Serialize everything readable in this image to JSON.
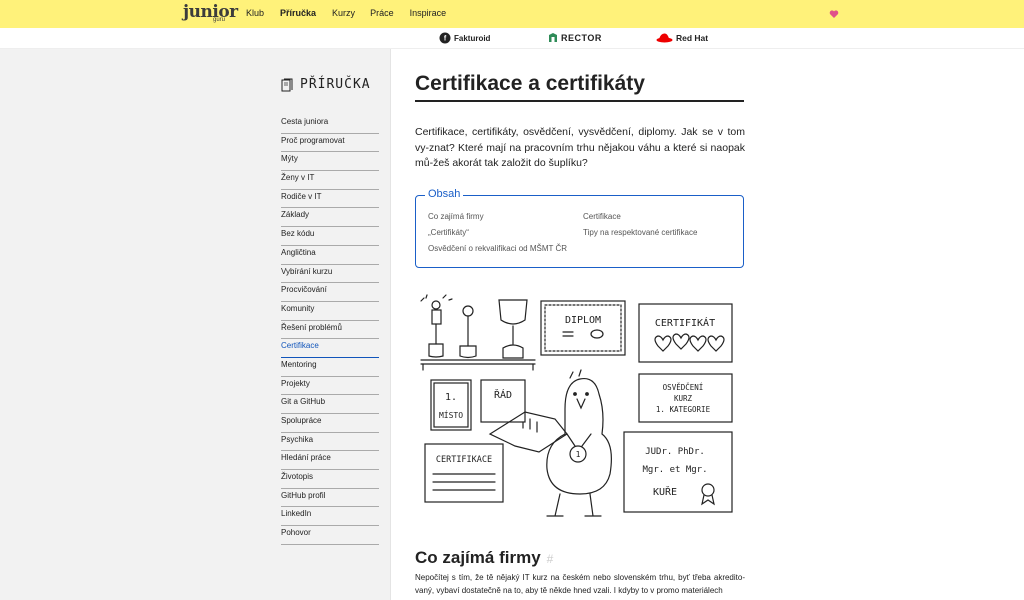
{
  "header": {
    "logo_main": "junior",
    "logo_sub": "guru",
    "nav": [
      "Klub",
      "Příručka",
      "Kurzy",
      "Práce",
      "Inspirace"
    ],
    "active_nav": "Příručka",
    "heart_color": "#e0508a",
    "bg_color": "#fff27a"
  },
  "sponsors": [
    "Fakturoid",
    "RECTOR",
    "Red Hat"
  ],
  "sidebar": {
    "title": "PŘÍRUČKA",
    "items": [
      "Cesta juniora",
      "Proč programovat",
      "Mýty",
      "Ženy v IT",
      "Rodiče v IT",
      "Základy",
      "Bez kódu",
      "Angličtina",
      "Vybírání kurzu",
      "Procvičování",
      "Komunity",
      "Řešení problémů",
      "Certifikace",
      "Mentoring",
      "Projekty",
      "Git a GitHub",
      "Spolupráce",
      "Psychika",
      "Hledání práce",
      "Životopis",
      "GitHub profil",
      "LinkedIn",
      "Pohovor"
    ],
    "active": "Certifikace"
  },
  "main": {
    "title": "Certifikace a certifikáty",
    "lead": "Certifikace, certifikáty, osvědčení, vysvědčení, diplomy. Jak se v tom vy-znat? Které mají na pracovním trhu nějakou váhu a které si naopak mů-žeš akorát tak založit do šuplíku?",
    "toc": {
      "legend": "Obsah",
      "links": [
        "Co zajímá firmy",
        "„Certifikáty“",
        "Osvědčení o rekvalifikaci od MŠMT ČR",
        "Certifikace",
        "Tipy na respektované certifikace"
      ]
    },
    "illustration": {
      "diplom": "DIPLOM",
      "certifikat": "CERTIFIKÁT",
      "misto_1": "1.",
      "misto_2": "MÍSTO",
      "rad": "ŘÁD",
      "osvedceni_1": "OSVĚDČENÍ",
      "osvedceni_2": "KURZ",
      "osvedceni_3": "1. KATEGORIE",
      "certifikace": "CERTIFIKACE",
      "titles_1": "JUDr. PhDr.",
      "titles_2": "Mgr. et Mgr.",
      "titles_3": "KUŘE",
      "medal": "1"
    },
    "section_heading": "Co zajímá firmy",
    "section_hash": "#",
    "paragraph": "Nepočítej s tím, že tě nějaký IT kurz na českém nebo slovenském trhu, byť třeba akredito-vaný, vybaví dostatečně na to, aby tě někde hned vzali. I kdyby to v promo materiálech"
  }
}
